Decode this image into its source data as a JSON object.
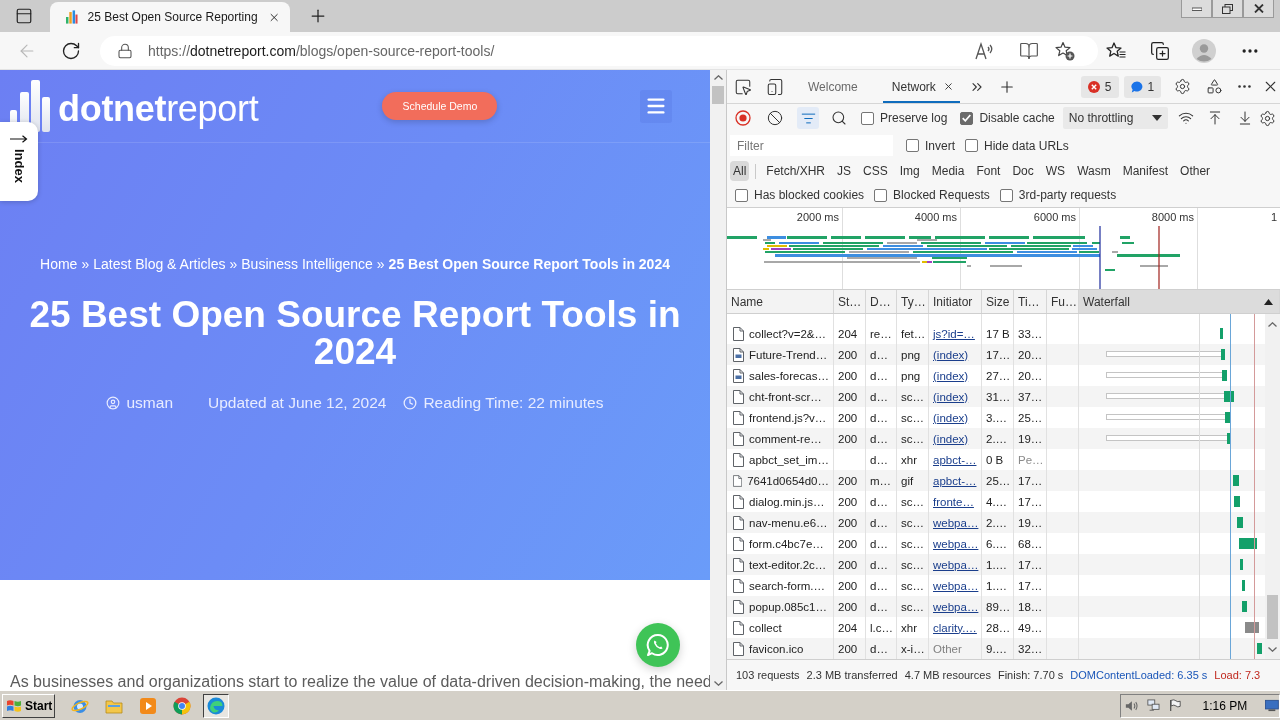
{
  "browser": {
    "tabs": [
      {
        "title": "25 Best Open Source Reporting",
        "selected": true
      }
    ],
    "back_button": {
      "disabled": true
    },
    "url": {
      "scheme": "https://",
      "host": "dotnetreport.com",
      "path": "/blogs/open-source-report-tools/"
    }
  },
  "page": {
    "logo": "**dotnet**report",
    "cta": "Schedule Demo",
    "index_tab": "Index",
    "breadcrumb": [
      {
        "label": "Home",
        "separator": "»",
        "current": false
      },
      {
        "label": "Latest Blog & Articles",
        "separator": "»",
        "current": false
      },
      {
        "label": "Business Intelligence",
        "separator": "»",
        "current": false
      },
      {
        "label": "25 Best Open Source Report Tools in 2024",
        "current": true
      }
    ],
    "title": "25 Best Open Source Report Tools in 2024",
    "meta": {
      "author": "usman",
      "updated": "Updated at June 12, 2024",
      "reading_time": "Reading Time: 22 minutes"
    },
    "intro": "As businesses and organizations start to realize the value of data-driven decision-making, the need"
  },
  "devtools": {
    "tabs": [
      {
        "label": "Welcome",
        "selected": false,
        "closable": false
      },
      {
        "label": "Network",
        "selected": true,
        "closable": true
      }
    ],
    "issues": {
      "errors": "5",
      "messages": "1"
    },
    "toolbar": {
      "recording": true,
      "filter_active": true,
      "options": [
        {
          "label": "Preserve log",
          "checked": false
        },
        {
          "label": "Disable cache",
          "checked": true
        }
      ],
      "throttling": "No throttling"
    },
    "filter": {
      "placeholder": "Filter",
      "options": [
        {
          "label": "Invert",
          "checked": false
        },
        {
          "label": "Hide data URLs",
          "checked": false
        }
      ]
    },
    "type_filters": [
      {
        "label": "All",
        "selected": true
      },
      {
        "label": "Fetch/XHR",
        "selected": false
      },
      {
        "label": "JS",
        "selected": false
      },
      {
        "label": "CSS",
        "selected": false
      },
      {
        "label": "Img",
        "selected": false
      },
      {
        "label": "Media",
        "selected": false
      },
      {
        "label": "Font",
        "selected": false
      },
      {
        "label": "Doc",
        "selected": false
      },
      {
        "label": "WS",
        "selected": false
      },
      {
        "label": "Wasm",
        "selected": false
      },
      {
        "label": "Manifest",
        "selected": false
      },
      {
        "label": "Other",
        "selected": false
      }
    ],
    "request_filters": [
      {
        "label": "Has blocked cookies",
        "checked": false
      },
      {
        "label": "Blocked Requests",
        "checked": false
      },
      {
        "label": "3rd-party requests",
        "checked": false
      }
    ],
    "overview": {
      "ticks": [
        "2000 ms",
        "4000 ms",
        "6000 ms",
        "8000 ms",
        "1"
      ]
    },
    "table": {
      "columns": [
        {
          "label": "Name",
          "sorted": false
        },
        {
          "label": "St…",
          "sorted": false
        },
        {
          "label": "D…",
          "sorted": false
        },
        {
          "label": "Ty…",
          "sorted": false
        },
        {
          "label": "Initiator",
          "sorted": false
        },
        {
          "label": "Size",
          "sorted": false
        },
        {
          "label": "Ti…",
          "sorted": false
        },
        {
          "label": "Fu…",
          "sorted": false
        },
        {
          "label": "Waterfall",
          "sorted": true
        }
      ],
      "rows": [
        {
          "name": "collect?v=2&…",
          "kind": "file",
          "status": "204",
          "domain": "re…",
          "type": "fet…",
          "initiator": "js?id=…",
          "initiator_link": true,
          "size": "17 B",
          "time": "33…",
          "pending": false
        },
        {
          "name": "Future-Trend…",
          "kind": "image",
          "status": "200",
          "domain": "d…",
          "type": "png",
          "initiator": "(index)",
          "initiator_link": true,
          "size": "17…",
          "time": "20…",
          "pending": false
        },
        {
          "name": "sales-forecas…",
          "kind": "image",
          "status": "200",
          "domain": "d…",
          "type": "png",
          "initiator": "(index)",
          "initiator_link": true,
          "size": "27…",
          "time": "20…",
          "pending": false
        },
        {
          "name": "cht-front-scr…",
          "kind": "file",
          "status": "200",
          "domain": "d…",
          "type": "sc…",
          "initiator": "(index)",
          "initiator_link": true,
          "size": "31…",
          "time": "37…",
          "pending": false
        },
        {
          "name": "frontend.js?v…",
          "kind": "file",
          "status": "200",
          "domain": "d…",
          "type": "sc…",
          "initiator": "(index)",
          "initiator_link": true,
          "size": "3.…",
          "time": "25…",
          "pending": false
        },
        {
          "name": "comment-re…",
          "kind": "file",
          "status": "200",
          "domain": "d…",
          "type": "sc…",
          "initiator": "(index)",
          "initiator_link": true,
          "size": "2.…",
          "time": "19…",
          "pending": false
        },
        {
          "name": "apbct_set_im…",
          "kind": "file",
          "domain": "d…",
          "type": "xhr",
          "initiator": "apbct-…",
          "initiator_link": true,
          "size": "0 B",
          "time": "Pe…",
          "pending": true
        },
        {
          "name": "7641d0654d0…",
          "kind": "file",
          "status": "200",
          "domain": "m…",
          "type": "gif",
          "initiator": "apbct-…",
          "initiator_link": true,
          "size": "25…",
          "time": "17…",
          "pending": false
        },
        {
          "name": "dialog.min.js…",
          "kind": "file",
          "status": "200",
          "domain": "d…",
          "type": "sc…",
          "initiator": "fronte…",
          "initiator_link": true,
          "size": "4.…",
          "time": "17…",
          "pending": false
        },
        {
          "name": "nav-menu.e6…",
          "kind": "file",
          "status": "200",
          "domain": "d…",
          "type": "sc…",
          "initiator": "webpa…",
          "initiator_link": true,
          "size": "2.…",
          "time": "19…",
          "pending": false
        },
        {
          "name": "form.c4bc7e…",
          "kind": "file",
          "status": "200",
          "domain": "d…",
          "type": "sc…",
          "initiator": "webpa…",
          "initiator_link": true,
          "size": "6.…",
          "time": "68…",
          "pending": false
        },
        {
          "name": "text-editor.2c…",
          "kind": "file",
          "status": "200",
          "domain": "d…",
          "type": "sc…",
          "initiator": "webpa…",
          "initiator_link": true,
          "size": "1.…",
          "time": "17…",
          "pending": false
        },
        {
          "name": "search-form.…",
          "kind": "file",
          "status": "200",
          "domain": "d…",
          "type": "sc…",
          "initiator": "webpa…",
          "initiator_link": true,
          "size": "1.…",
          "time": "17…",
          "pending": false
        },
        {
          "name": "popup.085c1…",
          "kind": "file",
          "status": "200",
          "domain": "d…",
          "type": "sc…",
          "initiator": "webpa…",
          "initiator_link": true,
          "size": "89…",
          "time": "18…",
          "pending": false
        },
        {
          "name": "collect",
          "kind": "file",
          "status": "204",
          "domain": "l.c…",
          "type": "xhr",
          "initiator": "clarity.…",
          "initiator_link": true,
          "size": "28…",
          "time": "49…",
          "pending": false
        },
        {
          "name": "favicon.ico",
          "kind": "file",
          "status": "200",
          "domain": "d…",
          "type": "x-i…",
          "initiator": "Other",
          "initiator_link": false,
          "size": "9.…",
          "time": "32…",
          "pending": false
        }
      ]
    },
    "status_bar": [
      {
        "text": "103 requests",
        "color": "#333333"
      },
      {
        "text": "2.3 MB transferred",
        "color": "#333333"
      },
      {
        "text": "4.7 MB resources",
        "color": "#333333"
      },
      {
        "text": "Finish: 7.70 s",
        "color": "#333333"
      },
      {
        "text": "DOMContentLoaded: 6.35 s",
        "color": "#1a56b8"
      },
      {
        "text": "Load: 7.3",
        "color": "#c0281e"
      }
    ]
  },
  "taskbar": {
    "start": "Start",
    "apps": [
      {
        "active": false
      },
      {
        "active": false
      },
      {
        "active": false
      },
      {
        "active": false
      },
      {
        "active": true
      }
    ],
    "clock": "1:16 PM"
  }
}
